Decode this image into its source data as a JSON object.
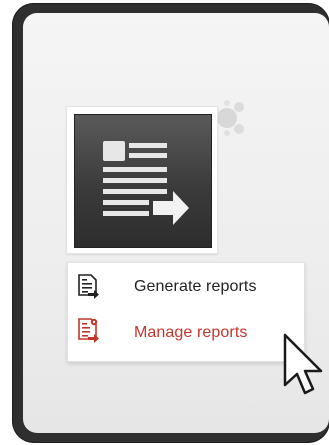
{
  "menu": {
    "items": [
      {
        "label": "Generate reports",
        "icon": "generate-report-icon",
        "color": "#222222"
      },
      {
        "label": "Manage reports",
        "icon": "manage-report-icon",
        "color": "#c4352b"
      }
    ]
  },
  "tile": {
    "icon": "report-export-icon"
  },
  "colors": {
    "frame": "#2f2f2f",
    "panel": "#f0f0f0",
    "accent_red": "#c4352b",
    "tile_dark": "#3b3b3b"
  }
}
